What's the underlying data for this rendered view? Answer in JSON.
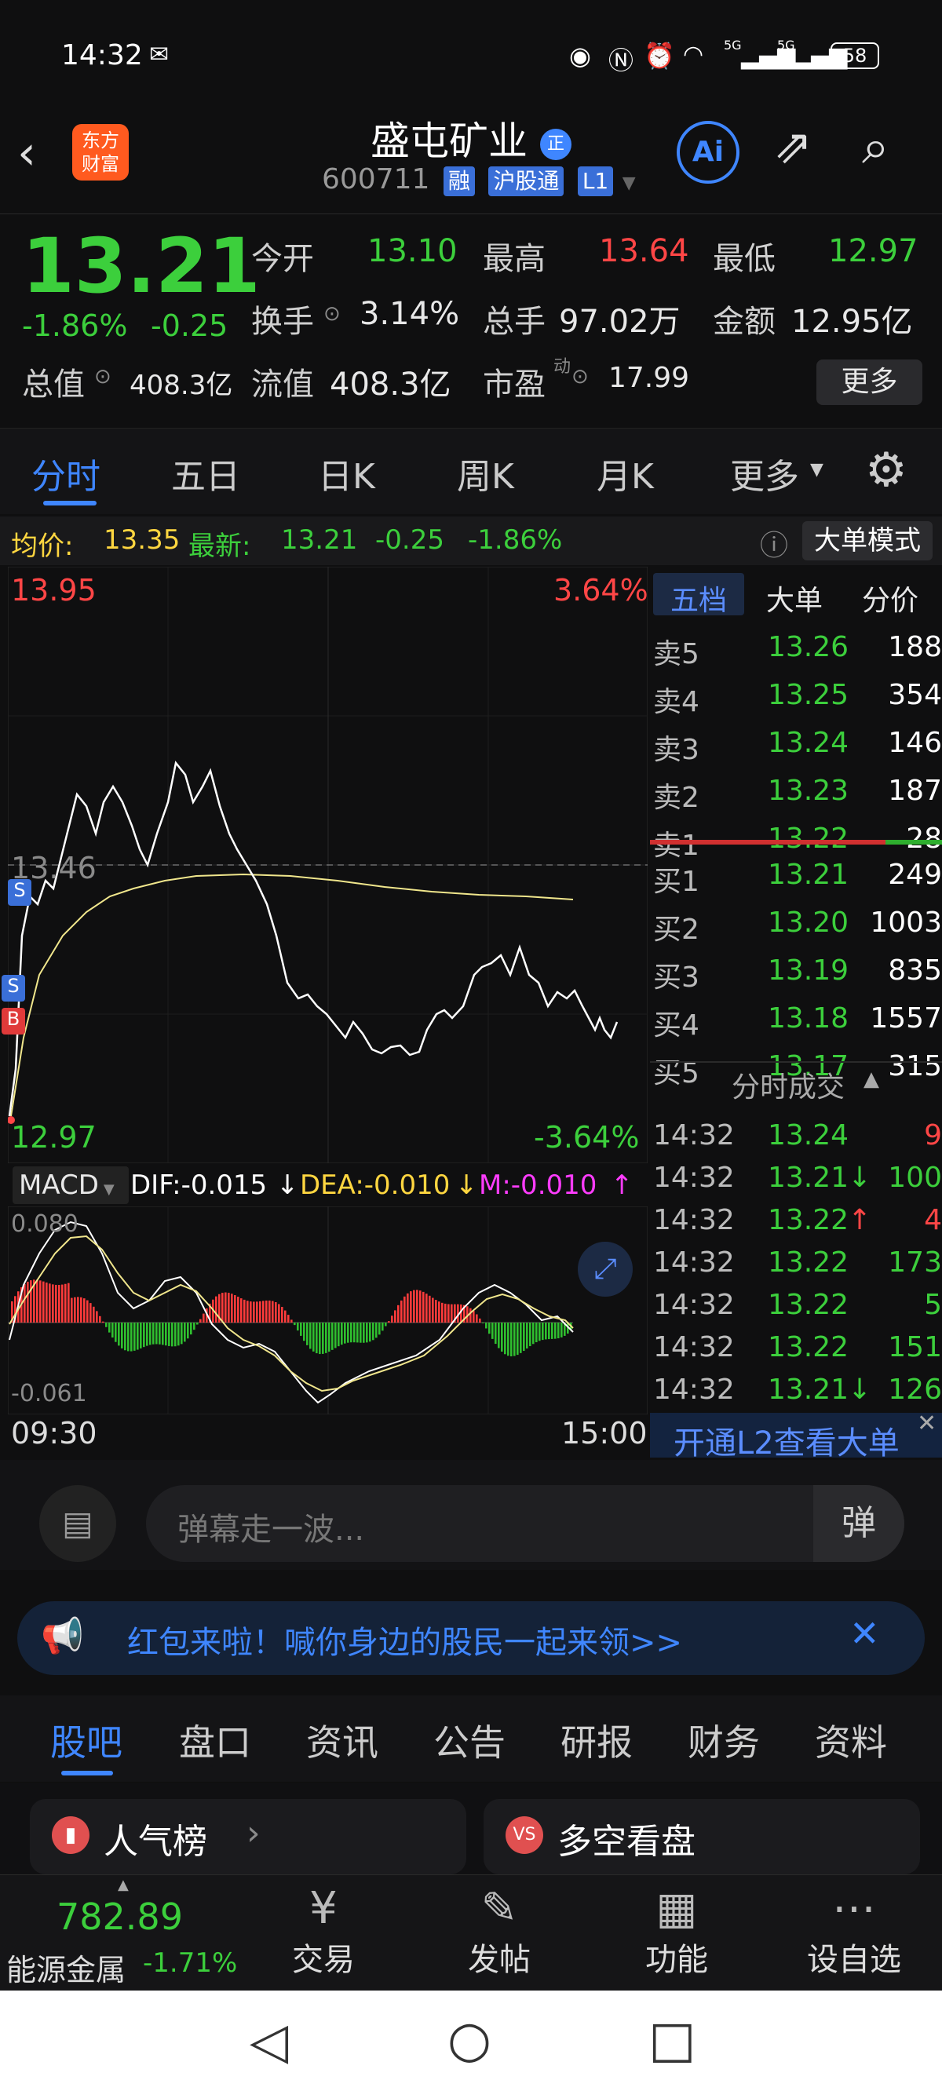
{
  "status": {
    "time": "14:32",
    "battery": "58",
    "signal1": "5G",
    "signal2": "5G"
  },
  "header": {
    "title": "盛屯矿业",
    "title_badge": "正",
    "code": "600711",
    "tag_rong": "融",
    "tag_hgt": "沪股通",
    "tag_l1": "L1",
    "logo_line1": "东方",
    "logo_line2": "财富",
    "ai": "Ai"
  },
  "quote": {
    "price": "13.21",
    "change_pct": "-1.86%",
    "change": "-0.25",
    "open_label": "今开",
    "open": "13.10",
    "high_label": "最高",
    "high": "13.64",
    "low_label": "最低",
    "low": "12.97",
    "turnover_label": "换手",
    "turnover": "3.14%",
    "volume_label": "总手",
    "volume": "97.02万",
    "amount_label": "金额",
    "amount": "12.95亿",
    "mcap_label": "总值",
    "mcap": "408.3亿",
    "float_label": "流值",
    "float": "408.3亿",
    "pe_label": "市盈",
    "pe_sup": "动",
    "pe": "17.99",
    "more": "更多"
  },
  "tabs": [
    "分时",
    "五日",
    "日K",
    "周K",
    "月K",
    "更多"
  ],
  "infobar": {
    "avg_label": "均价:",
    "avg": "13.35",
    "latest_label": "最新:",
    "latest": "13.21",
    "chg": "-0.25",
    "pct": "-1.86%",
    "mode": "大单模式"
  },
  "chart": {
    "ymax": "13.95",
    "ymin": "12.97",
    "pmax": "3.64%",
    "pmin": "-3.64%",
    "ref": "13.46",
    "time_start": "09:30",
    "time_end": "15:00",
    "marker_s": "S",
    "marker_b": "B"
  },
  "macd": {
    "name": "MACD",
    "dif": "DIF:-0.015",
    "dea": "DEA:-0.010",
    "m": "M:-0.010",
    "top": "0.080",
    "bottom": "-0.061"
  },
  "book": {
    "tabs": [
      "五档",
      "大单",
      "分价"
    ],
    "asks": [
      {
        "l": "卖5",
        "p": "13.26",
        "v": "188"
      },
      {
        "l": "卖4",
        "p": "13.25",
        "v": "354"
      },
      {
        "l": "卖3",
        "p": "13.24",
        "v": "146"
      },
      {
        "l": "卖2",
        "p": "13.23",
        "v": "187"
      },
      {
        "l": "卖1",
        "p": "13.22",
        "v": "28"
      }
    ],
    "bids": [
      {
        "l": "买1",
        "p": "13.21",
        "v": "249"
      },
      {
        "l": "买2",
        "p": "13.20",
        "v": "1003"
      },
      {
        "l": "买3",
        "p": "13.19",
        "v": "835"
      },
      {
        "l": "买4",
        "p": "13.18",
        "v": "1557"
      },
      {
        "l": "买5",
        "p": "13.17",
        "v": "315"
      }
    ],
    "trades_title": "分时成交",
    "trades": [
      {
        "t": "14:32",
        "p": "13.24",
        "a": "",
        "v": "9",
        "c": "red"
      },
      {
        "t": "14:32",
        "p": "13.21",
        "a": "↓",
        "v": "100",
        "c": "green"
      },
      {
        "t": "14:32",
        "p": "13.22",
        "a": "↑",
        "v": "4",
        "c": "red"
      },
      {
        "t": "14:32",
        "p": "13.22",
        "a": "",
        "v": "173",
        "c": "green"
      },
      {
        "t": "14:32",
        "p": "13.22",
        "a": "",
        "v": "5",
        "c": "green"
      },
      {
        "t": "14:32",
        "p": "13.22",
        "a": "",
        "v": "151",
        "c": "green"
      },
      {
        "t": "14:32",
        "p": "13.21",
        "a": "↓",
        "v": "126",
        "c": "green"
      }
    ],
    "l2": "开通L2查看大单"
  },
  "danmu": {
    "placeholder": "弹幕走一波...",
    "btn": "弹"
  },
  "banner": {
    "text": "红包来啦！喊你身边的股民一起来领>>"
  },
  "content_tabs": [
    "股吧",
    "盘口",
    "资讯",
    "公告",
    "研报",
    "财务",
    "资料"
  ],
  "cards": {
    "left": "人气榜",
    "right": "多空看盘",
    "right_icon": "VS"
  },
  "bottom": {
    "index_value": "782.89",
    "index_name": "能源金属",
    "index_pct": "-1.71%",
    "items": [
      "交易",
      "发帖",
      "功能",
      "设自选"
    ]
  },
  "colors": {
    "up": "#ff4646",
    "down": "#3ccf3c",
    "accent": "#3f86ff",
    "avg_line": "#f0e68c"
  }
}
